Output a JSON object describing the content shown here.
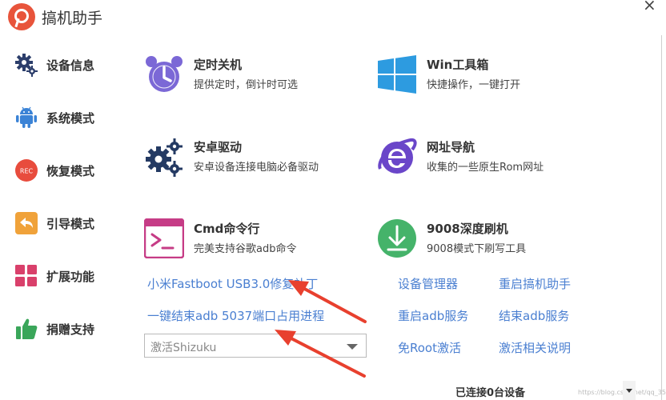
{
  "app": {
    "title": "搞机助手",
    "logo_icon": "app-logo-icon",
    "close_glyph": "×"
  },
  "sidebar": {
    "items": [
      {
        "label": "设备信息",
        "icon": "gears-icon",
        "color": "#2c3e6b"
      },
      {
        "label": "系统模式",
        "icon": "android-icon",
        "color": "#3b83d6"
      },
      {
        "label": "恢复模式",
        "icon": "rec-icon",
        "color": "#e84c3d",
        "icon_text": "REC"
      },
      {
        "label": "引导模式",
        "icon": "back-arrow-icon",
        "color": "#f0a23a"
      },
      {
        "label": "扩展功能",
        "icon": "grid-icon",
        "color": "#d9406b"
      },
      {
        "label": "捐赠支持",
        "icon": "thumbs-up-icon",
        "color": "#3aa65a"
      }
    ]
  },
  "tiles": [
    {
      "title": "定时关机",
      "desc": "提供定时，倒计时可选",
      "icon": "alarm-clock-icon",
      "color": "#7b68d6"
    },
    {
      "title": "Win工具箱",
      "desc": "快捷操作，一键打开",
      "icon": "windows-icon",
      "color": "#2d9be0"
    },
    {
      "title": "安卓驱动",
      "desc": "安卓设备连接电脑必备驱动",
      "icon": "gears-icon",
      "color": "#243a63"
    },
    {
      "title": "网址导航",
      "desc": "收集的一些原生Rom网址",
      "icon": "ie-icon",
      "color": "#6a46c9"
    },
    {
      "title": "Cmd命令行",
      "desc": "完美支持谷歌adb命令",
      "icon": "terminal-icon",
      "color": "#c63c86"
    },
    {
      "title": "9008深度刷机",
      "desc": "9008模式下刷写工具",
      "icon": "download-icon",
      "color": "#45b36a"
    }
  ],
  "links": {
    "fastboot_patch": "小米Fastboot USB3.0修复补丁",
    "kill_adb_5037": "一键结束adb 5037端口占用进程",
    "device_manager": "设备管理器",
    "restart_tool": "重启搞机助手",
    "restart_adb": "重启adb服务",
    "stop_adb": "结束adb服务",
    "root_free_activate": "免Root激活",
    "activate_help": "激活相关说明"
  },
  "activate_select": {
    "value": "激活Shizuku"
  },
  "status": {
    "text": "已连接0台设备",
    "watermark": "https://blog.csdn.net/qq_35..."
  },
  "colors": {
    "link": "#4a7fd1",
    "arrow": "#e8402e"
  }
}
